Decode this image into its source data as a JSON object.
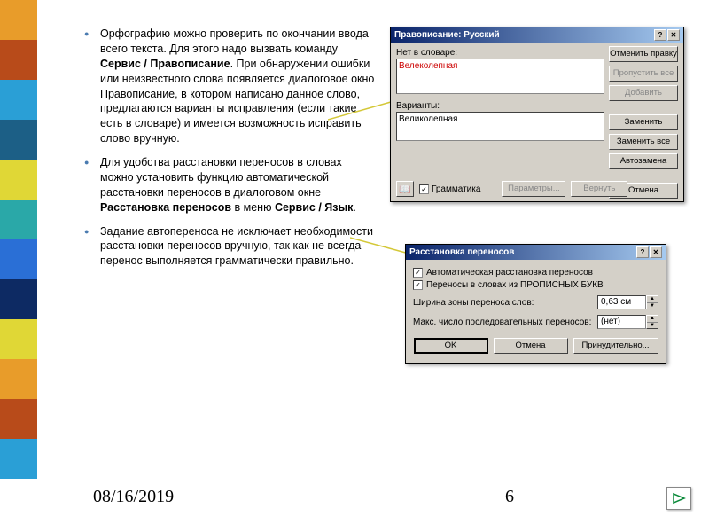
{
  "sidebar_colors": [
    "#e89c2a",
    "#b84b1a",
    "#2a9fd6",
    "#1c5f86",
    "#e0d736",
    "#2aa8a8",
    "#2a6fd6",
    "#0d2a63",
    "#e0d736",
    "#e89c2a",
    "#b84b1a",
    "#2a9fd6"
  ],
  "bullets": [
    {
      "pre": "Орфографию можно проверить по окончании ввода всего текста. Для этого надо вызвать команду ",
      "b1": "Сервис / Правописание",
      "post": ". При обнаружении ошибки или неизвестного слова появляется диалоговое окно Правописание, в котором написано данное слово, предлагаются варианты исправления (если такие есть в словаре) и имеется возможность исправить слово вручную."
    },
    {
      "pre": "Для удобства расстановки переносов в словах можно установить функцию автоматической расстановки переносов в диалоговом окне ",
      "b1": "Расстановка переносов",
      "mid": " в меню ",
      "b2": "Сервис / Язык",
      "post": "."
    },
    {
      "pre": "Задание автопереноса не исключает необходимости расстановки переносов вручную, так как не всегда перенос выполняется грамматически правильно."
    }
  ],
  "footer": {
    "date": "08/16/2019",
    "page": "6"
  },
  "dlg1": {
    "title": "Правописание: Русский",
    "lbl_notindict": "Нет в словаре:",
    "word": "Велеколепная",
    "lbl_variants": "Варианты:",
    "variant": "Великолепная",
    "btn_undo": "Отменить правку",
    "btn_skipall": "Пропустить все",
    "btn_add": "Добавить",
    "btn_replace": "Заменить",
    "btn_replaceall": "Заменить все",
    "btn_autoreplace": "Автозамена",
    "chk_grammar": "Грамматика",
    "btn_params": "Параметры...",
    "btn_return": "Вернуть",
    "btn_cancel": "Отмена"
  },
  "dlg2": {
    "title": "Расстановка переносов",
    "chk_auto": "Автоматическая расстановка переносов",
    "chk_caps": "Переносы в словах из ПРОПИСНЫХ БУКВ",
    "lbl_zone": "Ширина зоны переноса слов:",
    "val_zone": "0,63 см",
    "lbl_max": "Макс. число последовательных переносов:",
    "val_max": "(нет)",
    "btn_ok": "OK",
    "btn_cancel": "Отмена",
    "btn_force": "Принудительно..."
  }
}
